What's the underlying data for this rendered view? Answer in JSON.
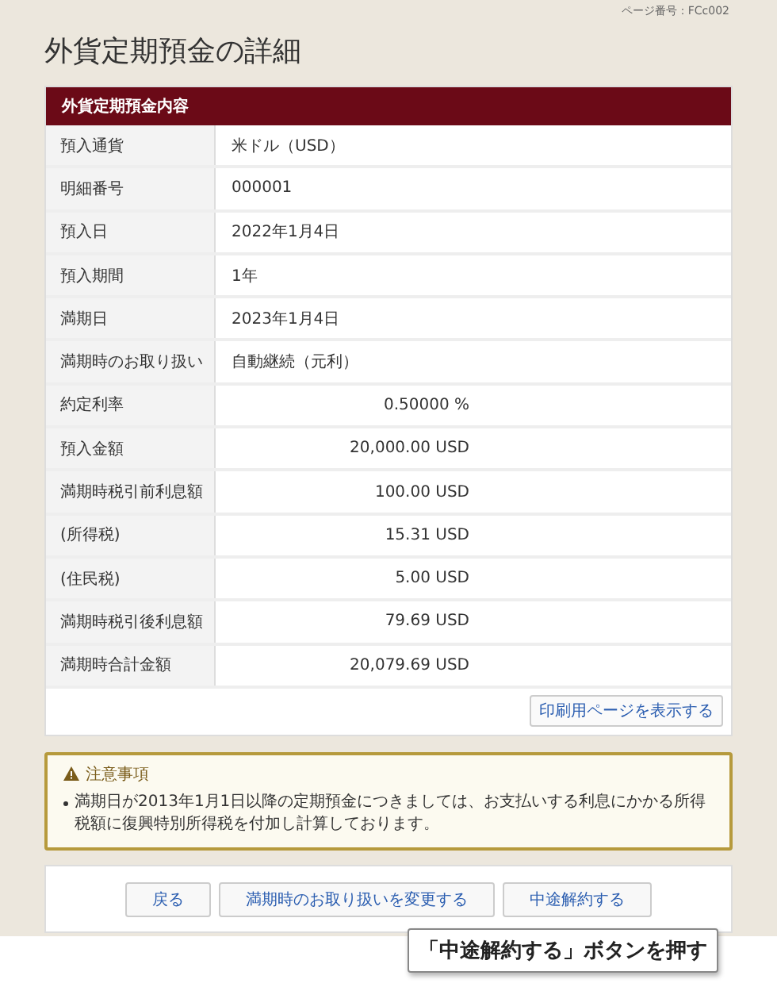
{
  "page_number": "ページ番号：FCc002",
  "title": "外貨定期預金の詳細",
  "section": {
    "heading": "外貨定期預金内容",
    "rows": [
      {
        "label": "預入通貨",
        "value": "米ドル（USD）",
        "kind": "text"
      },
      {
        "label": "明細番号",
        "value": "000001",
        "kind": "text"
      },
      {
        "label": "預入日",
        "value": "2022年1月4日",
        "kind": "text"
      },
      {
        "label": "預入期間",
        "value": "1年",
        "kind": "text"
      },
      {
        "label": "満期日",
        "value": "2023年1月4日",
        "kind": "text"
      },
      {
        "label": "満期時のお取り扱い",
        "value": "自動継続（元利）",
        "kind": "text"
      },
      {
        "label": "約定利率",
        "value": "0.50000 %",
        "kind": "amount"
      },
      {
        "label": "預入金額",
        "value": "20,000.00 USD",
        "kind": "amount"
      },
      {
        "label": "満期時税引前利息額",
        "value": "100.00 USD",
        "kind": "amount"
      },
      {
        "label": "(所得税)",
        "value": "15.31 USD",
        "kind": "amount"
      },
      {
        "label": "(住民税)",
        "value": "5.00 USD",
        "kind": "amount"
      },
      {
        "label": "満期時税引後利息額",
        "value": "79.69 USD",
        "kind": "amount"
      },
      {
        "label": "満期時合計金額",
        "value": "20,079.69 USD",
        "kind": "amount"
      }
    ],
    "print_button": "印刷用ページを表示する"
  },
  "notice": {
    "heading": "注意事項",
    "items": [
      "満期日が2013年1月1日以降の定期預金につきましては、お支払いする利息にかかる所得税額に復興特別所得税を付加し計算しております。"
    ]
  },
  "buttons": [
    {
      "label": "戻る"
    },
    {
      "label": "満期時のお取り扱いを変更する"
    },
    {
      "label": "中途解約する",
      "callout": "「中途解約する」ボタンを押す"
    }
  ]
}
